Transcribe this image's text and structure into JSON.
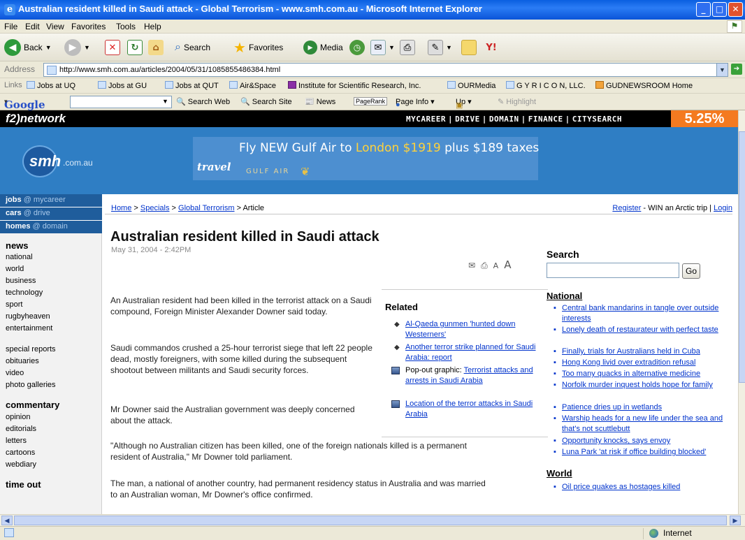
{
  "window": {
    "title": "Australian resident killed in Saudi attack - Global Terrorism - www.smh.com.au - Microsoft Internet Explorer"
  },
  "menu": [
    "File",
    "Edit",
    "View",
    "Favorites",
    "Tools",
    "Help"
  ],
  "toolbar": {
    "back": "Back",
    "search": "Search",
    "favorites": "Favorites",
    "media": "Media"
  },
  "address": {
    "label": "Address",
    "url": "http://www.smh.com.au/articles/2004/05/31/1085855486384.html",
    "go": "Go"
  },
  "links": {
    "label": "Links",
    "items": [
      "Jobs at UQ",
      "Jobs at GU",
      "Jobs at QUT",
      "Air&Space",
      "Institute for Scientific Research, Inc.",
      "OURMedia",
      "G Y R I C O N, LLC.",
      "GUDNEWSROOM Home"
    ]
  },
  "google": {
    "logo": "Google",
    "items": [
      "Search Web",
      "Search Site",
      "News",
      "PageRank",
      "Page Info",
      "Up",
      "Highlight"
    ]
  },
  "site": {
    "network": "f2)network",
    "nav": [
      "MYCAREER",
      "DRIVE",
      "DOMAIN",
      "FINANCE",
      "CITYSEARCH"
    ],
    "rate": "5.25%",
    "logo": "smh",
    "logo_suffix": ".com.au",
    "ad": {
      "line_prefix": "Fly NEW Gulf Air to ",
      "line_highlight": "London $1919",
      "line_suffix": " plus $189 taxes",
      "brand": "travel",
      "airline": "GULF AIR"
    }
  },
  "leftnav": {
    "top": [
      {
        "a": "jobs",
        "b": "@ mycareer"
      },
      {
        "a": "cars",
        "b": "@ drive"
      },
      {
        "a": "homes",
        "b": "@ domain"
      }
    ],
    "news_head": "news",
    "news": [
      "national",
      "world",
      "business",
      "technology",
      "sport",
      "rugbyheaven",
      "entertainment"
    ],
    "misc": [
      "special reports",
      "obituaries",
      "video",
      "photo galleries"
    ],
    "commentary_head": "commentary",
    "commentary": [
      "opinion",
      "editorials",
      "letters",
      "cartoons",
      "webdiary"
    ],
    "timeout_head": "time out"
  },
  "breadcrumb": [
    "Home",
    "Specials",
    "Global Terrorism",
    "Article"
  ],
  "toplinks": {
    "register": "Register",
    "win": " - WIN an Arctic trip | ",
    "login": "Login"
  },
  "article": {
    "headline": "Australian resident killed in Saudi attack",
    "date": "May 31, 2004 - 2:42PM",
    "paragraphs": [
      "An Australian resident had been killed in the terrorist attack on a Saudi compound, Foreign Minister Alexander Downer said today.",
      "Saudi commandos crushed a 25-hour terrorist siege that left 22 people dead, mostly foreigners, with some killed during the subsequent shootout between militants and Saudi security forces.",
      "Mr Downer said the Australian government was deeply concerned about the attack.",
      "\"Although no Australian citizen has been killed, one of the foreign nationals killed is a permanent resident of Australia,\" Mr Downer told parliament.",
      "The man, a national of another country, had permanent residency status in Australia and was married to an Australian woman, Mr Downer's office confirmed."
    ]
  },
  "related": {
    "title": "Related",
    "items": [
      {
        "text": "Al-Qaeda gunmen 'hunted down Westerners'"
      },
      {
        "text": "Another terror strike planned for Saudi Arabia: report"
      },
      {
        "prefix": "Pop-out graphic: ",
        "text": "Terrorist attacks and arrests in Saudi Arabia"
      },
      {
        "text": "Location of the terror attacks in Saudi Arabia"
      }
    ]
  },
  "sidebar": {
    "search_title": "Search",
    "go": "Go",
    "national_title": "National",
    "national": [
      "Central bank mandarins in tangle over outside interests",
      "Lonely death of restaurateur with perfect taste",
      "Finally, trials for Australians held in Cuba",
      "Hong Kong livid over extradition refusal",
      "Too many quacks in alternative medicine",
      "Norfolk murder inquest holds hope for family",
      "Patience dries up in wetlands",
      "Warship heads for a new life under the sea and that's not scuttlebutt",
      "Opportunity knocks, says envoy",
      "Luna Park 'at risk if office building blocked'"
    ],
    "world_title": "World",
    "world": [
      "Oil price quakes as hostages killed"
    ]
  },
  "status": {
    "zone": "Internet"
  }
}
